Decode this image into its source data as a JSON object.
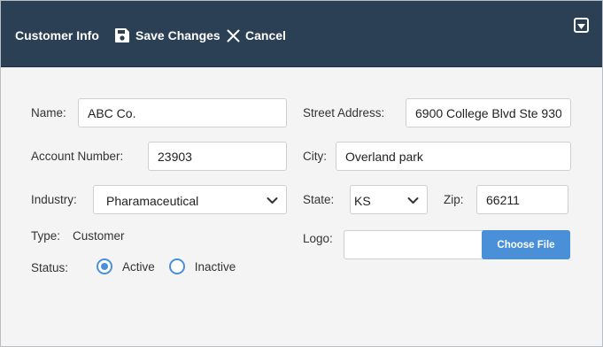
{
  "toolbar": {
    "title": "Customer Info",
    "save_label": "Save Changes",
    "cancel_label": "Cancel",
    "bg_color": "#2b3f55"
  },
  "form": {
    "name": {
      "label": "Name:",
      "value": "ABC Co."
    },
    "account_number": {
      "label": "Account Number:",
      "value": "23903"
    },
    "industry": {
      "label": "Industry:",
      "value": "Pharamaceutical"
    },
    "type": {
      "label": "Type:",
      "value": "Customer"
    },
    "status": {
      "label": "Status:",
      "options": [
        {
          "label": "Active",
          "selected": true
        },
        {
          "label": "Inactive",
          "selected": false
        }
      ]
    },
    "street_address": {
      "label": "Street Address:",
      "value": "6900 College Blvd Ste 930"
    },
    "city": {
      "label": "City:",
      "value": "Overland park"
    },
    "state": {
      "label": "State:",
      "value": "KS"
    },
    "zip": {
      "label": "Zip:",
      "value": "66211"
    },
    "logo": {
      "label": "Logo:",
      "button_label": "Choose File"
    }
  },
  "icons": {
    "save": "floppy-disk-icon",
    "cancel": "close-icon",
    "menu": "chevron-down-box-icon",
    "select": "chevron-down-icon"
  },
  "colors": {
    "accent": "#4a90d9",
    "page_bg": "#f4f4f4"
  }
}
